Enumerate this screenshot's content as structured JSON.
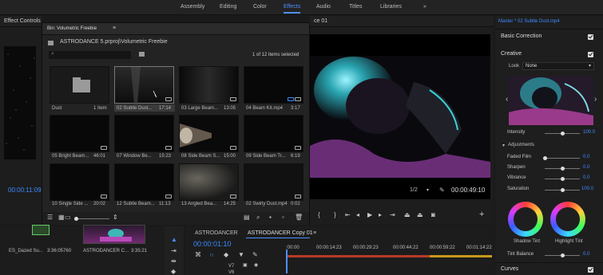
{
  "workspaces": [
    "Assembly",
    "Editing",
    "Color",
    "Effects",
    "Audio",
    "Titles",
    "Libraries"
  ],
  "more_glyph": "»",
  "left_panel": {
    "title": "Effect Controls",
    "timecode": "00:00:11:09"
  },
  "bin": {
    "title": "Bin: Volumetric Freebie",
    "path": "ASTRODANCE 5.prproj\\Volumetric Freebie",
    "count": "1 of 12 items selected",
    "items": [
      {
        "name": "Dust",
        "meta": "1 Item"
      },
      {
        "name": "02 Subtle Dust...",
        "meta": "17:14"
      },
      {
        "name": "03 Large Beam...",
        "meta": "13:05"
      },
      {
        "name": "04 Beam Kit.mp4",
        "meta": "3:17"
      },
      {
        "name": "05 Bright Beam...",
        "meta": "46:01"
      },
      {
        "name": "07 Window Be...",
        "meta": "15:23"
      },
      {
        "name": "08 Side Beam S...",
        "meta": "15:00"
      },
      {
        "name": "09 Side Beam Tr...",
        "meta": "6:19"
      },
      {
        "name": "10 Single Side ...",
        "meta": "20:02"
      },
      {
        "name": "12 Subtle Beam...",
        "meta": "11:13"
      },
      {
        "name": "13 Angled Bea...",
        "meta": "14:25"
      },
      {
        "name": "02 Swirly Dust.mp4",
        "meta": "0:02"
      }
    ]
  },
  "program": {
    "title": "ce 01",
    "zoom": "1/2",
    "timecode": "00:00:49:10"
  },
  "lumetri": {
    "master": "Master * 02 Subtle Dust.mp4",
    "basic": "Basic Correction",
    "creative": "Creative",
    "look_label": "Look",
    "look_value": "None",
    "intensity_label": "Intensity",
    "intensity_value": "100.0",
    "adjustments": "Adjustments",
    "rows": [
      {
        "label": "Faded Film",
        "value": "0.0",
        "level": 0.0
      },
      {
        "label": "Sharpen",
        "value": "0.0",
        "level": 0.5
      },
      {
        "label": "Vibrance",
        "value": "0.0",
        "level": 0.5
      },
      {
        "label": "Saturation",
        "value": "100.0",
        "level": 0.5
      }
    ],
    "shadow_tint": "Shadow Tint",
    "highlight_tint": "Highlight Tint",
    "tint_balance": "Tint Balance",
    "tint_balance_value": "0.0",
    "curves": "Curves"
  },
  "source_media": {
    "clip1_name": "ES_Dazed Su...",
    "clip1_dur": "3:36:05760",
    "clip2_name": "ASTRODANCER C...",
    "clip2_dur": "3:35:21"
  },
  "timeline": {
    "tab1": "ASTRODANCER",
    "tab2": "ASTRODANCER Copy 01",
    "timecode": "00:00:01:10",
    "ruler": [
      ":00:00",
      "00:00:14:23",
      "00:00:29:23",
      "00:00:44:22",
      "00:00:59:22",
      "00:01:14:22"
    ],
    "tracks": [
      "V7",
      "V6"
    ]
  },
  "colors": {
    "accent": "#4d8fff",
    "bluetc": "#3d8bff"
  }
}
